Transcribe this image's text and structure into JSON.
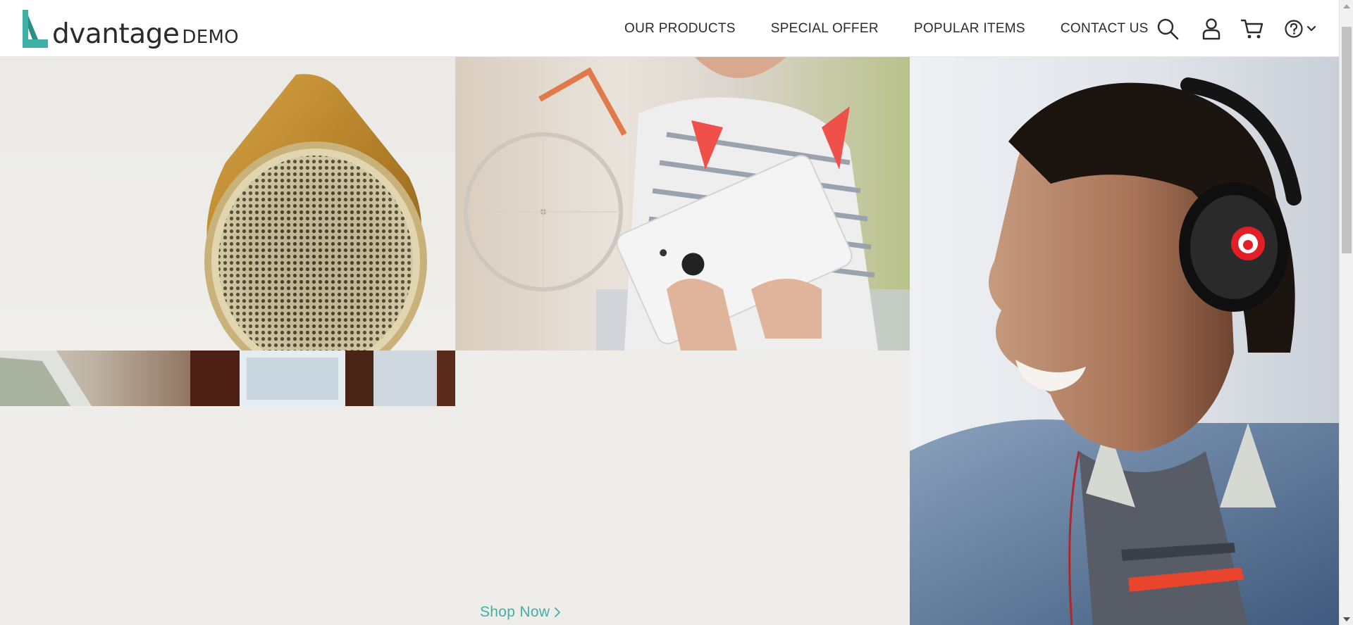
{
  "header": {
    "logo": {
      "word": "dvantage",
      "demo": "DEMO"
    },
    "nav": [
      {
        "label": "OUR PRODUCTS"
      },
      {
        "label": "SPECIAL OFFER"
      },
      {
        "label": "POPULAR ITEMS"
      },
      {
        "label": "CONTACT US"
      }
    ],
    "icons": [
      "search-icon",
      "user-icon",
      "cart-icon",
      "help-icon",
      "chevron-down-icon"
    ]
  },
  "hero": {
    "shop_now_label": "Shop Now"
  },
  "colors": {
    "accent": "#3fb0a7",
    "logo_mark": "#3fb0a7",
    "text": "#2b2b2b",
    "speaker_gold": "#b8862a",
    "background": "#eeede9"
  }
}
